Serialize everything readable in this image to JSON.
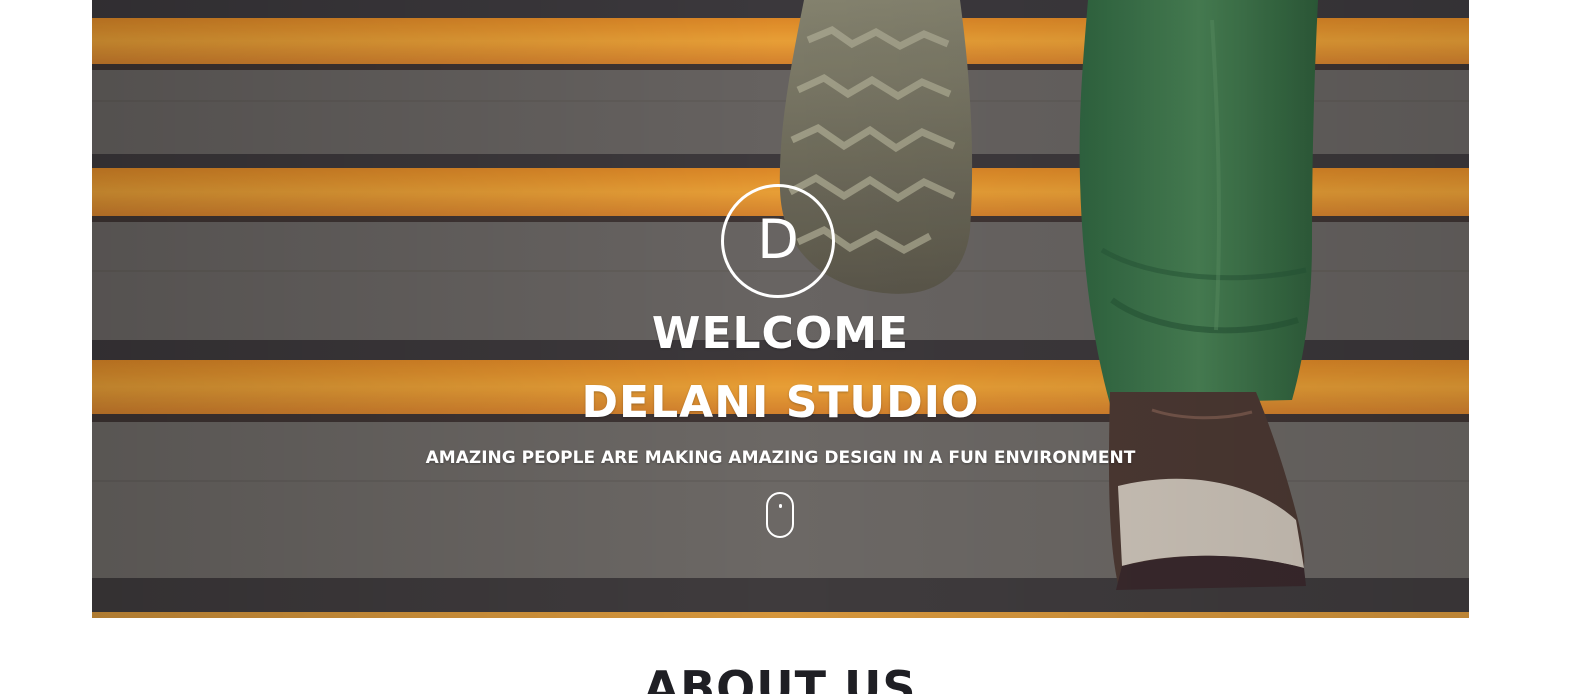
{
  "hero": {
    "logo_letter": "D",
    "welcome": "WELCOME",
    "studio": "DELANI STUDIO",
    "tagline": "AMAZING PEOPLE ARE MAKING AMAZING DESIGN IN A FUN ENVIRONMENT",
    "scroll_icon": "mouse-scroll-icon"
  },
  "about": {
    "title": "ABOUT US"
  },
  "colors": {
    "hero_text": "#ffffff",
    "about_text": "#1f1f24",
    "stair_orange": "#f2a23a",
    "stair_gray": "#6e6b63",
    "jeans_green": "#3f7a4a",
    "shoe_brown": "#5a4433"
  }
}
